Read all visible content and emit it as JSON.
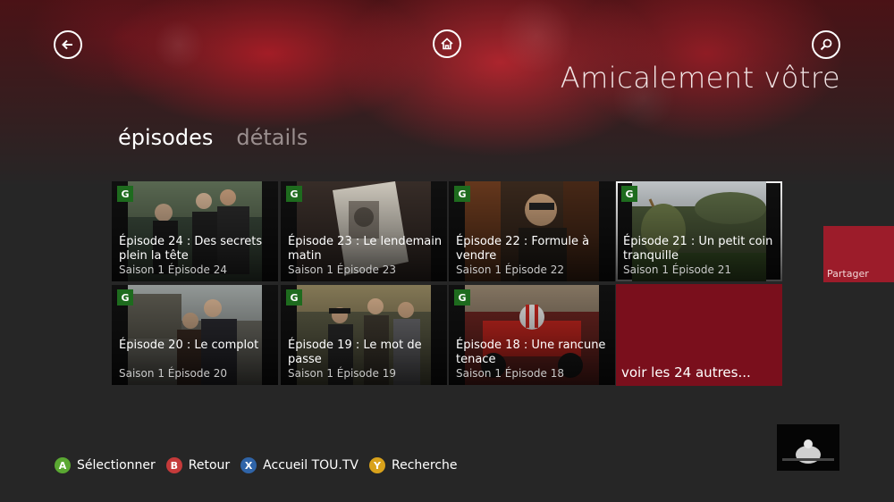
{
  "app": {
    "title": "Amicalement vôtre"
  },
  "nav": {
    "back_icon": "arrow-left-icon",
    "home_icon": "home-icon",
    "search_icon": "search-icon"
  },
  "pivot": {
    "active": "épisodes",
    "inactive": "détails"
  },
  "episodes": [
    {
      "rating": "G",
      "title": "Épisode 24 : Des secrets plein la tête",
      "sub": "Saison 1 Épisode 24"
    },
    {
      "rating": "G",
      "title": "Épisode 23 : Le lendemain matin",
      "sub": "Saison 1 Épisode 23"
    },
    {
      "rating": "G",
      "title": "Épisode 22 : Formule à vendre",
      "sub": "Saison 1 Épisode 22"
    },
    {
      "rating": "G",
      "title": "Épisode 21 : Un petit coin tranquille",
      "sub": "Saison 1 Épisode 21"
    },
    {
      "rating": "G",
      "title": "Épisode 20 : Le complot",
      "sub": "Saison 1 Épisode 20"
    },
    {
      "rating": "G",
      "title": "Épisode 19 : Le mot de passe",
      "sub": "Saison 1 Épisode 19"
    },
    {
      "rating": "G",
      "title": "Épisode 18 : Une rancune tenace",
      "sub": "Saison 1 Épisode 18"
    }
  ],
  "more_tile": {
    "label": "voir les  24 autres..."
  },
  "share": {
    "label": "Partager"
  },
  "controller_legend": [
    {
      "button": "A",
      "label": "Sélectionner",
      "color": "#5aa832"
    },
    {
      "button": "B",
      "label": "Retour",
      "color": "#c53a3a"
    },
    {
      "button": "X",
      "label": "Accueil TOU.TV",
      "color": "#2f64a8"
    },
    {
      "button": "Y",
      "label": "Recherche",
      "color": "#d9a21b"
    }
  ],
  "colors": {
    "accent": "#7a0f1c",
    "share": "#9c1c2a",
    "rating_badge": "#1e6b1e"
  }
}
